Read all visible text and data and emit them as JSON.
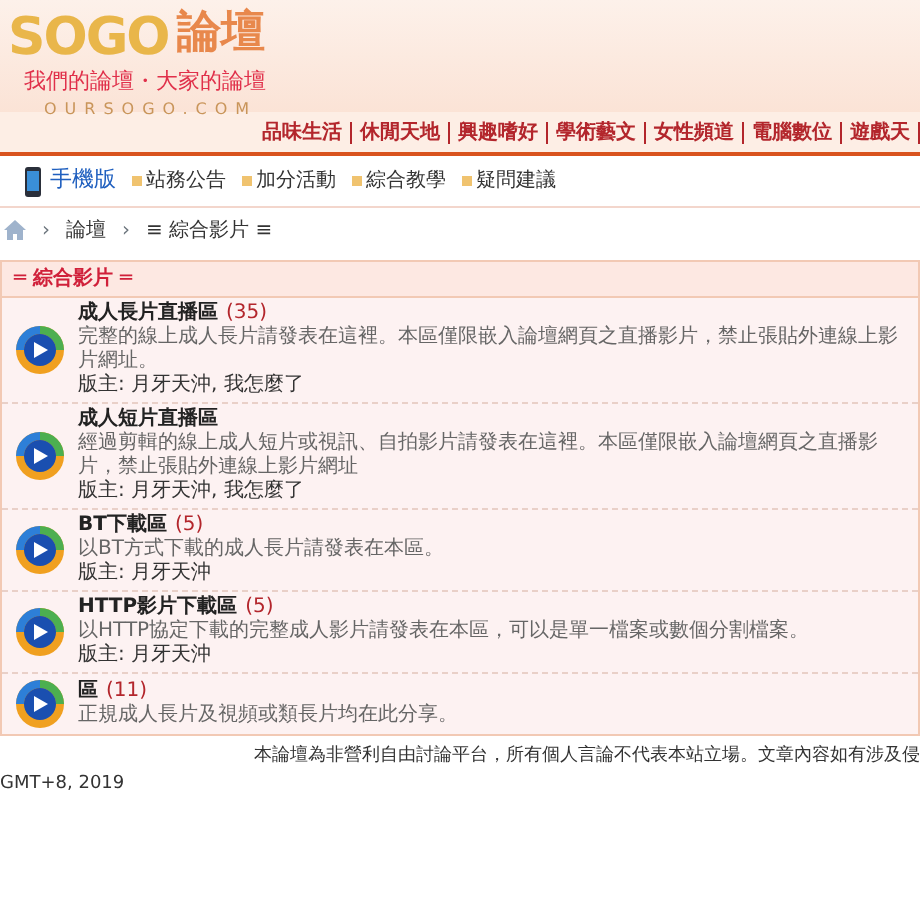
{
  "header": {
    "logo": "SOGO",
    "logo_suffix": "論壇",
    "slogan": "我們的論壇・大家的論壇",
    "domain": "OURSOGO.COM"
  },
  "top_nav": [
    "品味生活",
    "休閒天地",
    "興趣嗜好",
    "學術藝文",
    "女性頻道",
    "電腦數位",
    "遊戲天"
  ],
  "sub_nav": {
    "mobile": "手機版",
    "links": [
      "站務公告",
      "加分活動",
      "綜合教學",
      "疑問建議"
    ]
  },
  "breadcrumb": [
    {
      "separator": "›",
      "label": "論壇"
    },
    {
      "separator": "›",
      "label": "≡ 綜合影片 ≡"
    }
  ],
  "section": {
    "title": "═ 綜合影片 ═",
    "forums": [
      {
        "title": "成人長片直播區",
        "count": "(35)",
        "description": "完整的線上成人長片請發表在這裡。本區僅限嵌入論壇網頁之直播影片，禁止張貼外連線上影片網址。",
        "moderators": "版主: 月牙天沖, 我怎麼了"
      },
      {
        "title": "成人短片直播區",
        "description": "經過剪輯的線上成人短片或視訊、自拍影片請發表在這裡。本區僅限嵌入論壇網頁之直播影片，禁止張貼外連線上影片網址",
        "moderators": "版主: 月牙天沖, 我怎麼了"
      },
      {
        "title": "BT下載區",
        "count": "(5)",
        "description": "以BT方式下載的成人長片請發表在本區。",
        "moderators": "版主: 月牙天沖"
      },
      {
        "title": "HTTP影片下載區",
        "count": "(5)",
        "description": "以HTTP協定下載的完整成人影片請發表在本區，可以是單一檔案或數個分割檔案。",
        "moderators": "版主: 月牙天沖"
      },
      {
        "title": "區",
        "count": "(11)",
        "description": "正規成人長片及視頻或類長片均在此分享。"
      }
    ]
  },
  "footer": {
    "notice": "本論壇為非營利自由討論平台，所有個人言論不代表本站立場。文章內容如有涉及侵",
    "time": "GMT+8, 2019"
  }
}
